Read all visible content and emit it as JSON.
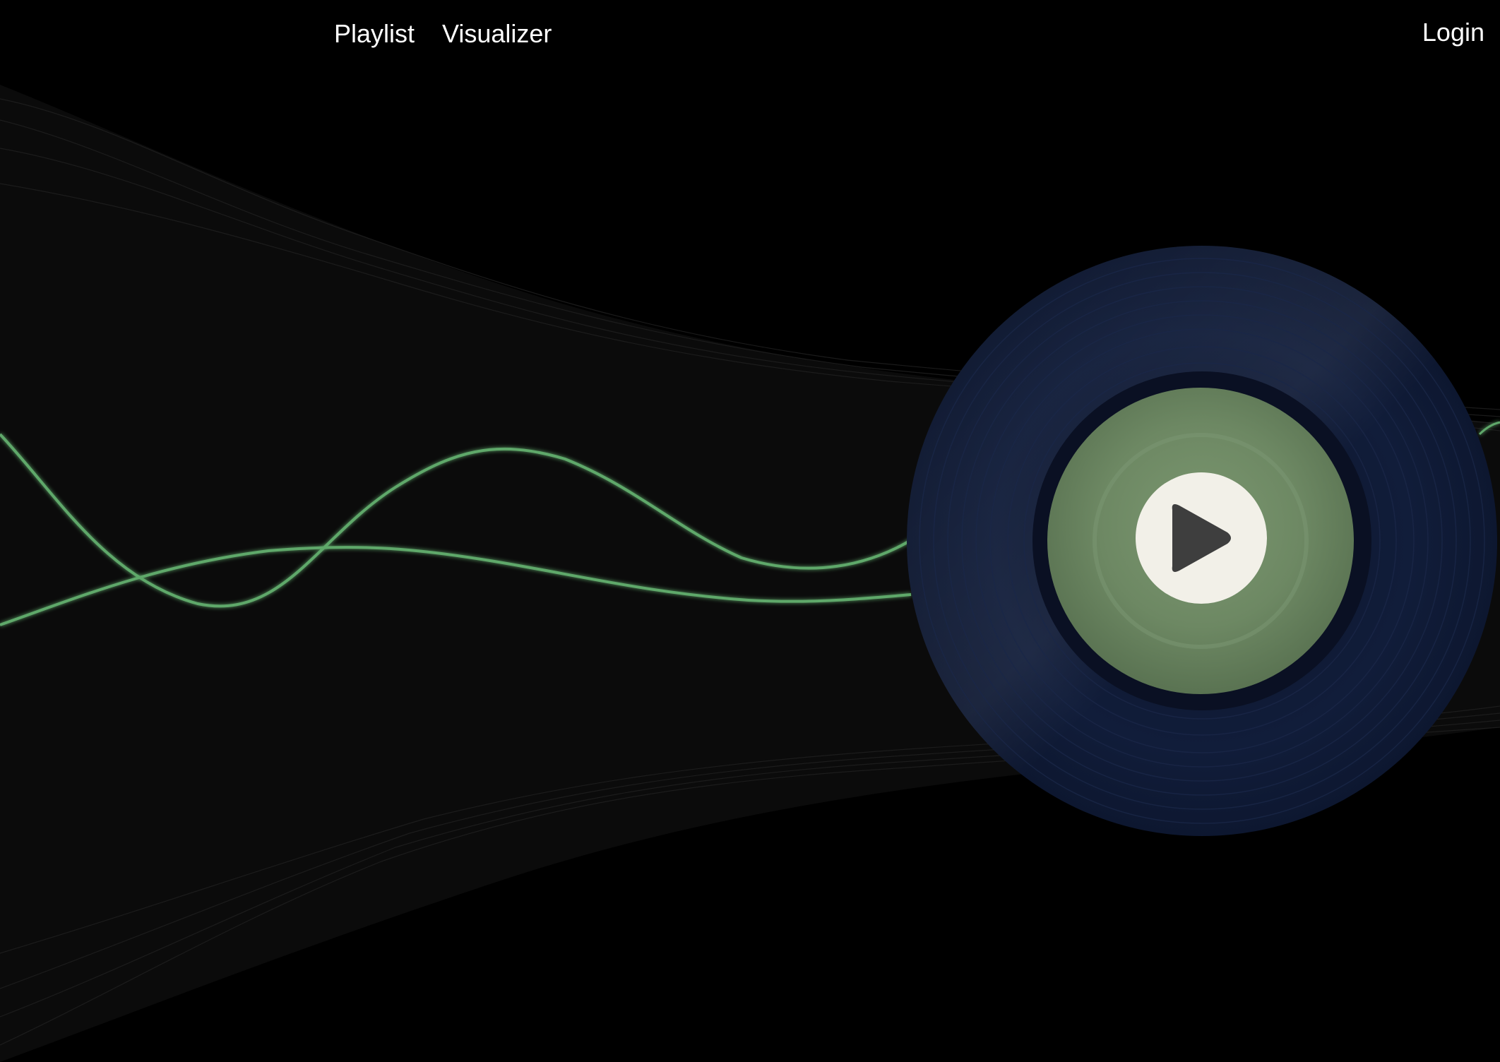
{
  "nav": {
    "playlist_label": "Playlist",
    "visualizer_label": "Visualizer",
    "login_label": "Login"
  },
  "colors": {
    "background": "#000000",
    "haze": "#0c0c0c",
    "wave": "#5fa86a",
    "record_outer": "#0f1a33",
    "record_label": "#6f8a64",
    "play_circle": "#f2f0e8",
    "play_triangle": "#3e3e3e"
  },
  "icons": {
    "play": "play-icon",
    "record": "vinyl-record-icon"
  }
}
